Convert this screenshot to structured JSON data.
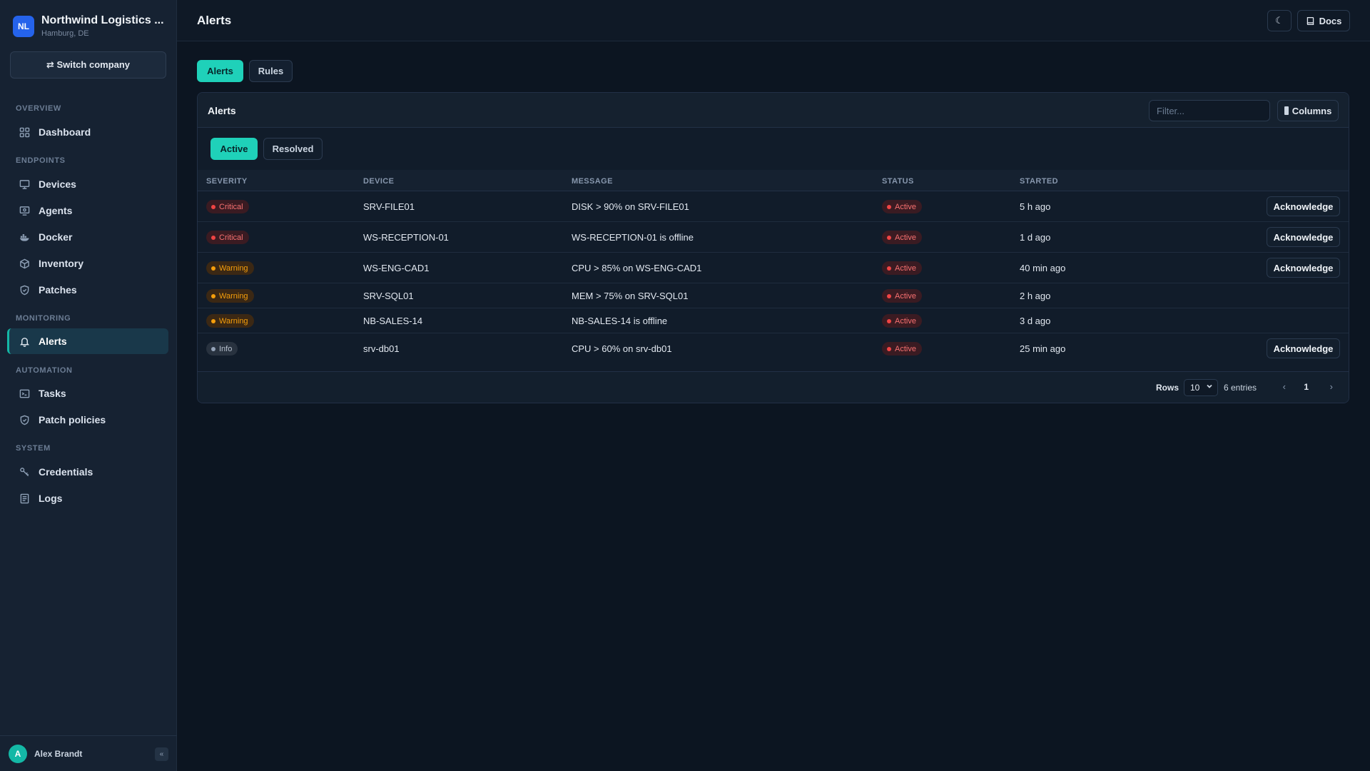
{
  "company": {
    "initials": "NL",
    "name": "Northwind Logistics ...",
    "location": "Hamburg, DE",
    "switch_label": "⇄ Switch company"
  },
  "nav": {
    "sections": [
      "OVERVIEW",
      "ENDPOINTS",
      "MONITORING",
      "AUTOMATION",
      "SYSTEM"
    ],
    "items": [
      {
        "label": "Dashboard",
        "icon": "dashboard-icon"
      },
      {
        "label": "Devices",
        "icon": "monitor-icon"
      },
      {
        "label": "Agents",
        "icon": "agent-icon"
      },
      {
        "label": "Docker",
        "icon": "docker-icon"
      },
      {
        "label": "Inventory",
        "icon": "box-icon"
      },
      {
        "label": "Patches",
        "icon": "shield-icon"
      },
      {
        "label": "Alerts",
        "icon": "bell-icon",
        "active": true
      },
      {
        "label": "Tasks",
        "icon": "terminal-icon"
      },
      {
        "label": "Patch policies",
        "icon": "shield-check-icon"
      },
      {
        "label": "Credentials",
        "icon": "key-icon"
      },
      {
        "label": "Logs",
        "icon": "log-icon"
      }
    ]
  },
  "user": {
    "initial": "A",
    "name": "Alex Brandt",
    "collapse": "«"
  },
  "header": {
    "title": "Alerts",
    "theme_icon": "☾",
    "docs_label": "Docs"
  },
  "tabs": [
    "Alerts",
    "Rules"
  ],
  "card": {
    "title": "Alerts",
    "filter_placeholder": "Filter...",
    "columns_label": "Columns",
    "segments": [
      "Active",
      "Resolved"
    ],
    "columns": [
      "SEVERITY",
      "DEVICE",
      "MESSAGE",
      "STATUS",
      "STARTED"
    ],
    "rows": [
      {
        "severity": "Critical",
        "device": "SRV-FILE01",
        "message": "DISK > 90% on SRV-FILE01",
        "status": "Active",
        "started": "5 h ago",
        "action": "Acknowledge"
      },
      {
        "severity": "Critical",
        "device": "WS-RECEPTION-01",
        "message": "WS-RECEPTION-01 is offline",
        "status": "Active",
        "started": "1 d ago",
        "action": "Acknowledge"
      },
      {
        "severity": "Warning",
        "device": "WS-ENG-CAD1",
        "message": "CPU > 85% on WS-ENG-CAD1",
        "status": "Active",
        "started": "40 min ago",
        "action": "Acknowledge"
      },
      {
        "severity": "Warning",
        "device": "SRV-SQL01",
        "message": "MEM > 75% on SRV-SQL01",
        "status": "Active",
        "started": "2 h ago",
        "action": ""
      },
      {
        "severity": "Warning",
        "device": "NB-SALES-14",
        "message": "NB-SALES-14 is offline",
        "status": "Active",
        "started": "3 d ago",
        "action": ""
      },
      {
        "severity": "Info",
        "device": "srv-db01",
        "message": "CPU > 60% on srv-db01",
        "status": "Active",
        "started": "25 min ago",
        "action": "Acknowledge"
      }
    ],
    "footer": {
      "rows_label": "Rows",
      "rows_value": "10",
      "entries": "6 entries",
      "prev": "‹",
      "page": "1",
      "next": "›"
    }
  },
  "colors": {
    "accent": "#1fd1b9",
    "critical": "#ef4444",
    "warning": "#f59e0b",
    "info": "#94a3b8",
    "brand": "#2563eb"
  }
}
